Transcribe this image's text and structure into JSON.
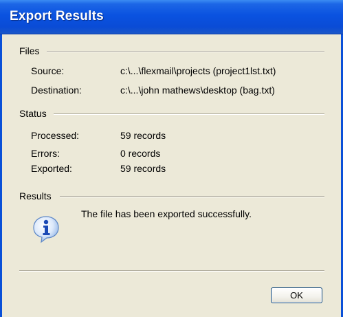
{
  "window": {
    "title": "Export Results"
  },
  "files": {
    "group_label": "Files",
    "source_label": "Source:",
    "source_value": "c:\\...\\flexmail\\projects (project1lst.txt)",
    "destination_label": "Destination:",
    "destination_value": "c:\\...\\john mathews\\desktop (bag.txt)"
  },
  "status": {
    "group_label": "Status",
    "processed_label": "Processed:",
    "processed_value": "59 records",
    "errors_label": "Errors:",
    "errors_value": "0 records",
    "exported_label": "Exported:",
    "exported_value": "59 records"
  },
  "results": {
    "group_label": "Results",
    "icon": "information-icon",
    "message": "The file has been exported successfully."
  },
  "buttons": {
    "ok_label": "OK"
  },
  "colors": {
    "titlebar": "#0A52E0",
    "dialog_bg": "#ECE9D8",
    "button_border": "#003C74"
  }
}
